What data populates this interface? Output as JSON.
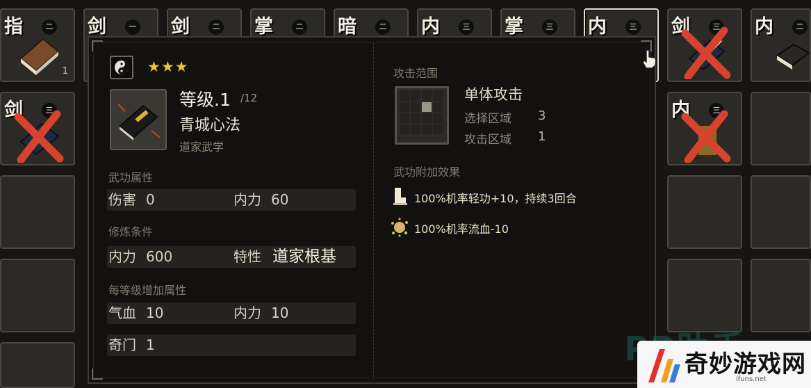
{
  "inventory": {
    "slots": [
      {
        "tag": "指",
        "tier": "二",
        "count": "1"
      },
      {
        "tag": "剑",
        "tier": "一"
      },
      {
        "tag": "剑",
        "tier": "二"
      },
      {
        "tag": "掌",
        "tier": "二"
      },
      {
        "tag": "暗",
        "tier": "二"
      },
      {
        "tag": "内",
        "tier": "三"
      },
      {
        "tag": "掌",
        "tier": "三"
      },
      {
        "tag": "内",
        "tier": "三"
      },
      {
        "tag": "剑",
        "tier": "三"
      },
      {
        "tag": "内",
        "tier": "二"
      },
      {
        "tag": "剑",
        "tier": "三"
      },
      {
        "tag": "内",
        "tier": "三"
      }
    ]
  },
  "tooltip": {
    "stars": "★★★",
    "level_label": "等级.1",
    "level_max": "/12",
    "skill_name": "青城心法",
    "school": "道家武学",
    "attr_title": "武功属性",
    "attr_row": {
      "k1": "伤害",
      "v1": "0",
      "k2": "内力",
      "v2": "60"
    },
    "req_title": "修炼条件",
    "req_row": {
      "k1": "内力",
      "v1": "600",
      "k2": "特性",
      "v2": "道家根基"
    },
    "growth_title": "每等级增加属性",
    "growth_row": {
      "k1": "气血",
      "v1": "10",
      "k2": "内力",
      "v2": "10"
    },
    "extra_row": {
      "k1": "奇门",
      "v1": "1"
    },
    "range_title": "攻击范围",
    "range_type": "单体攻击",
    "select_area_label": "选择区域",
    "select_area_value": "3",
    "attack_area_label": "攻击区域",
    "attack_area_value": "1",
    "effects_title": "武功附加效果",
    "effects": [
      {
        "text": "100%机率轻功+10，持续3回合",
        "icon": "boot-icon"
      },
      {
        "text": "100%机率流血-10",
        "icon": "blood-splat-icon"
      }
    ]
  },
  "watermark": {
    "faint_text": "PP助手",
    "logo_text": "奇妙游戏网",
    "logo_url": "ifuns.net"
  },
  "colors": {
    "star": "#f2c230",
    "cross_red": "#d8432e",
    "panel_bg": "#121110",
    "slot_bg": "#2b2a27"
  }
}
